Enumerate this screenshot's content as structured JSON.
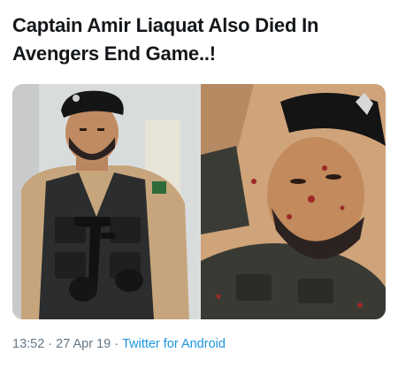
{
  "tweet": {
    "text": "Captain Amir Liaquat Also Died In Avengers End Game..!"
  },
  "media": {
    "photos": [
      {
        "subject": "man in black beret and tactical vest holding rifle"
      },
      {
        "subject": "close-up of injured man lying down wearing beret"
      }
    ]
  },
  "meta": {
    "time": "13:52",
    "separator": "·",
    "date": "27 Apr 19",
    "source": "Twitter for Android"
  }
}
